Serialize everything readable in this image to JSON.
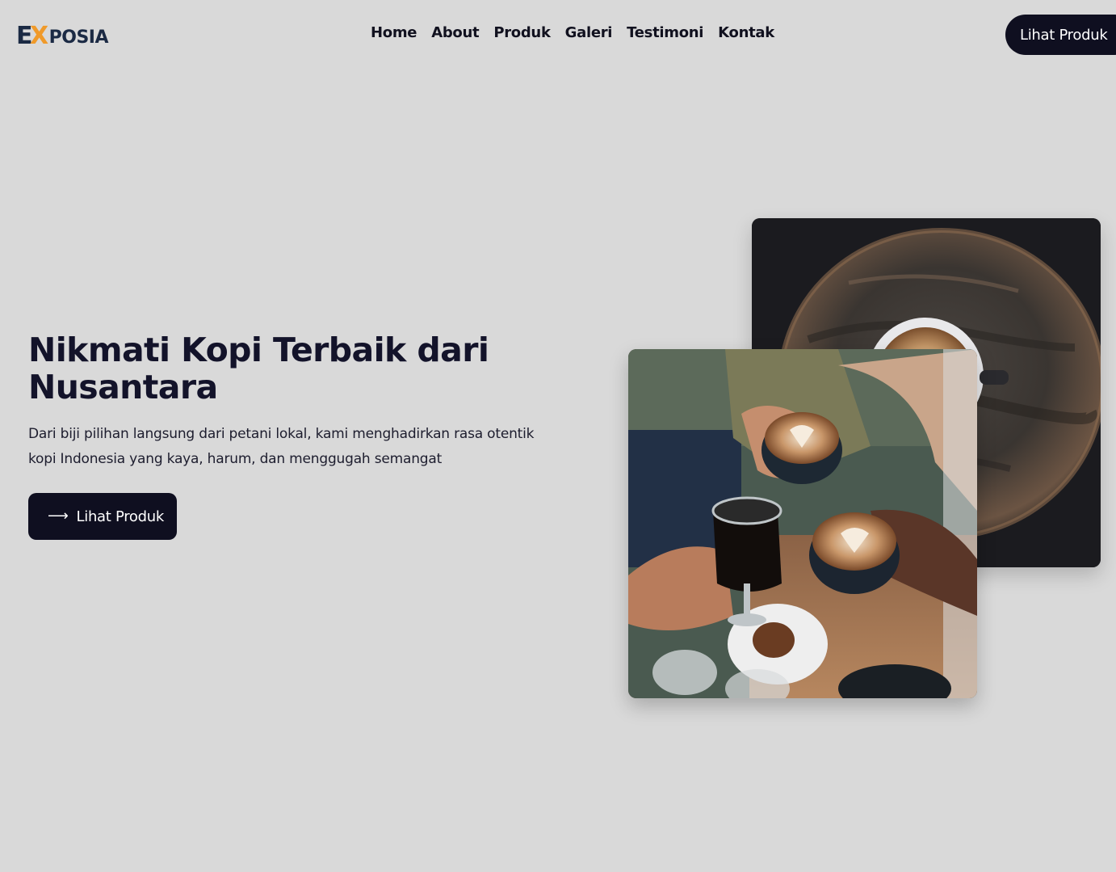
{
  "brand": {
    "logo_e": "E",
    "logo_x": "X",
    "logo_rest": "POSIA",
    "colors": {
      "primary": "#1b2a44",
      "accent": "#f09a2a",
      "dark": "#0f0f20",
      "background": "#d9d9d9"
    }
  },
  "nav": {
    "items": [
      "Home",
      "About",
      "Produk",
      "Galeri",
      "Testimoni",
      "Kontak"
    ]
  },
  "header_cta": {
    "label": "Lihat Produk"
  },
  "hero": {
    "title": "Nikmati Kopi Terbaik dari Nusantara",
    "description": "Dari biji pilihan langsung dari petani lokal, kami menghadirkan rasa otentik kopi Indonesia yang kaya, harum, dan menggugah semangat",
    "button_label": "Lihat Produk",
    "button_icon": "arrow-right-icon"
  },
  "images": {
    "back": "coffee-on-wooden-table-photo",
    "front": "people-toasting-coffee-photo"
  }
}
